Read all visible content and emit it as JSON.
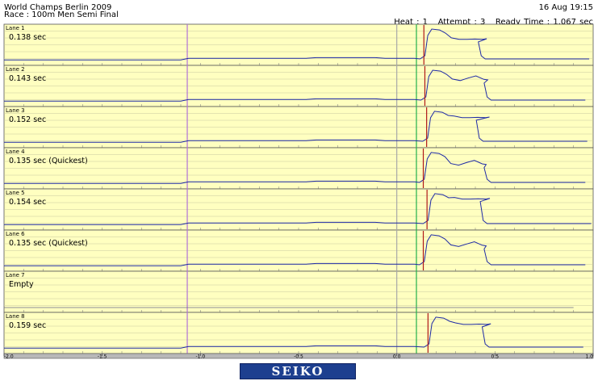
{
  "header": {
    "event": "World Champs Berlin 2009",
    "race": "Race : 100m Men Semi Final",
    "date": "16 Aug 19:15",
    "heat": "Heat : 1",
    "attempt": "Attempt : 3",
    "ready_time": "Ready Time : 1.067 sec"
  },
  "colors": {
    "panel_bg": "#ffffc0",
    "grid": "#c8c8a0",
    "trace": "#1e2aa6",
    "flat_trace": "#6a6a8a",
    "marker_purple": "#b070d8",
    "marker_gray": "#a8a8a8",
    "marker_green": "#22b14c",
    "reaction_red": "#b01818",
    "logo_bg": "#1d3f8f"
  },
  "chart_data": {
    "type": "line",
    "title": "",
    "xlabel": "",
    "ylabel": "",
    "xlim": [
      -2.0,
      1.0
    ],
    "x_ticks": [
      "-2.0",
      "-1.5",
      "-1.0",
      "-0.5",
      "0.0",
      "0.5",
      "1.0"
    ],
    "grid": true,
    "reference_lines": [
      {
        "x": -1.067,
        "color": "purple"
      },
      {
        "x": 0.0,
        "color": "gray"
      },
      {
        "x": 0.1,
        "color": "green"
      }
    ],
    "lanes": [
      {
        "name": "Lane 1",
        "value_label": "0.138 sec",
        "reaction": 0.138,
        "empty": false,
        "peak": 0.95,
        "mid": 0.62,
        "end": 0.43,
        "second_peak": false
      },
      {
        "name": "Lane 2",
        "value_label": "0.143 sec",
        "reaction": 0.143,
        "empty": false,
        "peak": 0.95,
        "mid": 0.62,
        "end": 0.46,
        "second_peak": true
      },
      {
        "name": "Lane 3",
        "value_label": "0.152 sec",
        "reaction": 0.152,
        "empty": false,
        "peak": 0.95,
        "mid": 0.75,
        "end": 0.42,
        "second_peak": false
      },
      {
        "name": "Lane 4",
        "value_label": "0.135 sec (Quickest)",
        "reaction": 0.135,
        "empty": false,
        "peak": 0.95,
        "mid": 0.55,
        "end": 0.46,
        "second_peak": true
      },
      {
        "name": "Lane 5",
        "value_label": "0.154 sec",
        "reaction": 0.154,
        "empty": false,
        "peak": 0.95,
        "mid": 0.78,
        "end": 0.44,
        "second_peak": false
      },
      {
        "name": "Lane 6",
        "value_label": "0.135 sec (Quickest)",
        "reaction": 0.135,
        "empty": false,
        "peak": 0.95,
        "mid": 0.58,
        "end": 0.46,
        "second_peak": true
      },
      {
        "name": "Lane 7",
        "value_label": "Empty",
        "reaction": null,
        "empty": true,
        "peak": 0,
        "mid": 0,
        "end": 0,
        "second_peak": false
      },
      {
        "name": "Lane 8",
        "value_label": "0.159 sec",
        "reaction": 0.159,
        "empty": false,
        "peak": 0.95,
        "mid": 0.72,
        "end": 0.45,
        "second_peak": false
      }
    ]
  },
  "logo": {
    "text": "SEIKO"
  }
}
